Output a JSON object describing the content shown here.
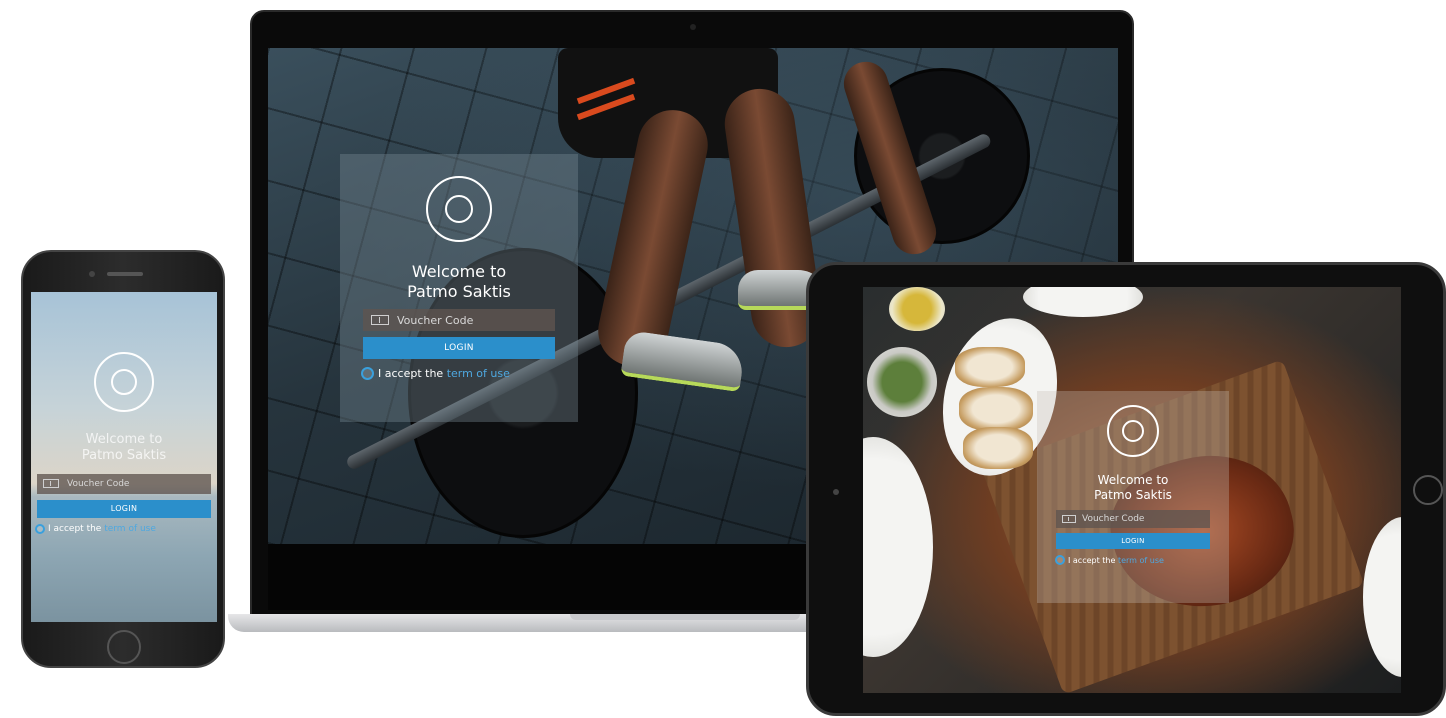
{
  "app": {
    "title_line1": "Welcome to",
    "title_line2": "Patmo Saktis",
    "voucher_placeholder": "Voucher Code",
    "login_label": "LOGIN",
    "accept_prefix": "I accept the ",
    "terms_label": "term of use"
  },
  "colors": {
    "accent": "#2b8fcb",
    "link": "#4ea8e0",
    "card_bg": "rgba(120,140,150,0.38)"
  },
  "icons": {
    "logo": "ring-logo-icon",
    "voucher": "ticket-icon",
    "radio": "radio-circle-icon"
  }
}
